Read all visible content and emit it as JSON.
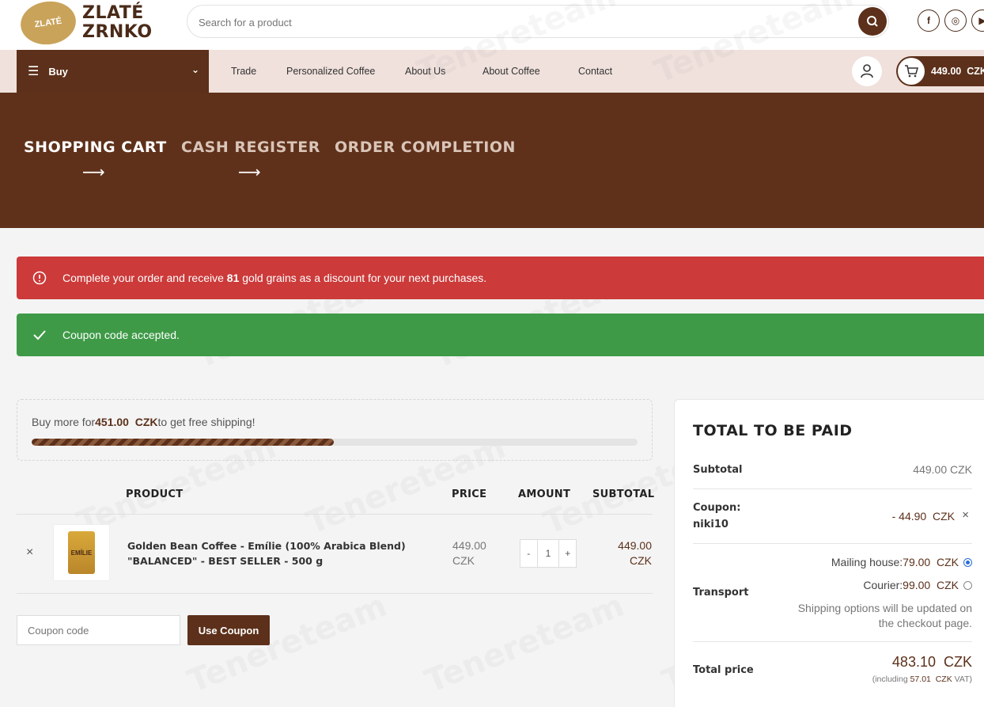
{
  "header": {
    "logo_line1": "ZLATÉ",
    "logo_line2": "ZRNKO",
    "search_placeholder": "Search for a product",
    "socials": [
      "f",
      "◎",
      "▶"
    ]
  },
  "nav": {
    "buy_label": "Buy",
    "items": [
      "Trade",
      "Personalized Coffee",
      "About Us",
      "About Coffee",
      "Contact"
    ],
    "cart_amount": "449.00",
    "cart_currency": "CZK"
  },
  "steps": [
    "SHOPPING CART",
    "CASH REGISTER",
    "ORDER COMPLETION"
  ],
  "notices": {
    "reward_prefix": "Complete your order and receive ",
    "reward_amount": "81",
    "reward_suffix": " gold grains as a discount for your next purchases.",
    "coupon_accepted": "Coupon code accepted."
  },
  "shipping": {
    "prefix": "Buy more for",
    "amount": "451.00",
    "currency": "CZK",
    "suffix": "to get free shipping!",
    "progress_fraction": 0.499
  },
  "cart": {
    "headers": {
      "product": "PRODUCT",
      "price": "PRICE",
      "amount": "AMOUNT",
      "subtotal": "SUBTOTAL"
    },
    "item": {
      "name_line1": "Golden Bean Coffee - Emílie (100% Arabica Blend)",
      "name_line2": "\"BALANCED\" - BEST SELLER - 500 g",
      "price": "449.00",
      "price_currency": "CZK",
      "quantity": "1",
      "subtotal": "449.00",
      "subtotal_currency": "CZK",
      "bag_text": "EMÍLIE"
    },
    "coupon_placeholder": "Coupon code",
    "coupon_button": "Use Coupon"
  },
  "totals": {
    "title": "TOTAL TO BE PAID",
    "subtotal_label": "Subtotal",
    "subtotal_value": "449.00  CZK",
    "coupon_label": "Coupon:",
    "coupon_code": "niki10",
    "coupon_value": "- 44.90",
    "coupon_currency": "CZK",
    "transport_label": "Transport",
    "mailing_label": "Mailing house:",
    "mailing_value": "79.00",
    "courier_label": "Courier:",
    "courier_value": "99.00",
    "currency": "CZK",
    "shipping_note_1": "Shipping options will be updated on",
    "shipping_note_2": "the checkout page.",
    "total_label": "Total price",
    "total_value": "483.10",
    "total_currency": "CZK",
    "vat_prefix": "(including",
    "vat_value": "57.01",
    "vat_suffix": "VAT)"
  },
  "watermark": "Tenereteam",
  "colors": {
    "brand": "#5c301a",
    "hero": "#5f311b",
    "nav_bg": "#f0e1dc",
    "error": "#cc3a3a",
    "success": "#3e9a47"
  }
}
